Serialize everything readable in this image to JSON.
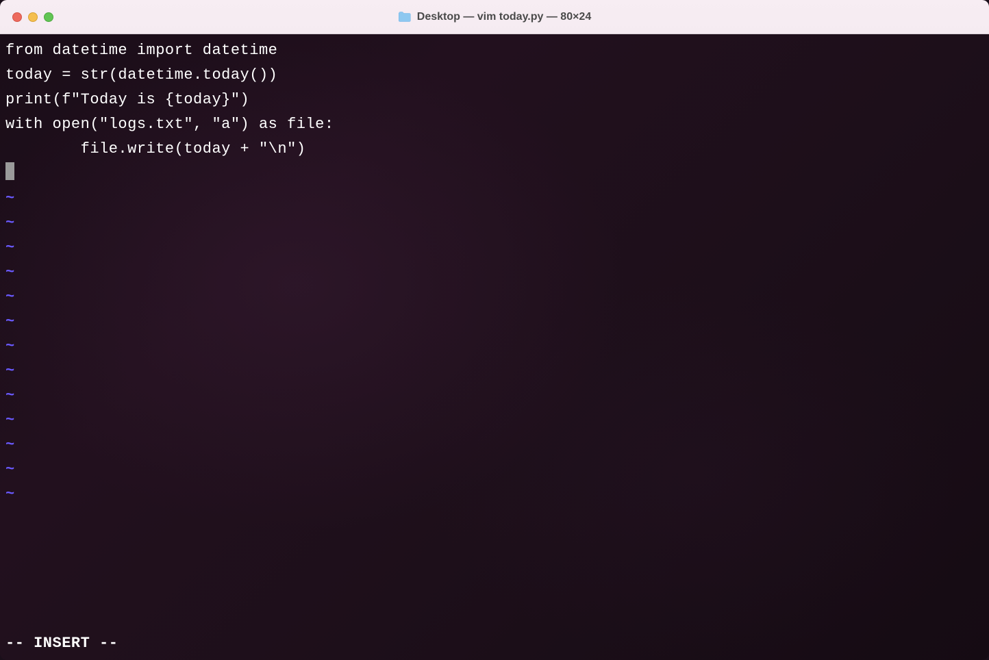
{
  "window": {
    "title": "Desktop — vim today.py — 80×24",
    "folder_icon": "folder-icon"
  },
  "editor": {
    "lines": [
      "from datetime import datetime",
      "",
      "today = str(datetime.today())",
      "",
      "print(f\"Today is {today}\")",
      "",
      "with open(\"logs.txt\", \"a\") as file:",
      "        file.write(today + \"\\n\")"
    ],
    "empty_line_marker": "~",
    "empty_line_count": 13,
    "mode_status": "-- INSERT --"
  }
}
